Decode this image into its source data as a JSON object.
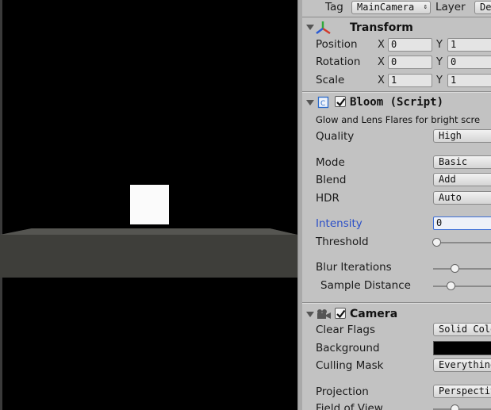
{
  "top": {
    "tag_label": "Tag",
    "tag_value": "MainCamera",
    "layer_label": "Layer",
    "layer_value": "De"
  },
  "transform": {
    "title": "Transform",
    "rows": [
      {
        "label": "Position",
        "x": "0",
        "y": "1"
      },
      {
        "label": "Rotation",
        "x": "0",
        "y": "0"
      },
      {
        "label": "Scale",
        "x": "1",
        "y": "1"
      }
    ],
    "axis_x": "X",
    "axis_y": "Y"
  },
  "bloom": {
    "title": "Bloom (Script)",
    "description": "Glow and Lens Flares for bright scre",
    "quality_label": "Quality",
    "quality_value": "High",
    "mode_label": "Mode",
    "mode_value": "Basic",
    "blend_label": "Blend",
    "blend_value": "Add",
    "hdr_label": "HDR",
    "hdr_value": "Auto",
    "intensity_label": "Intensity",
    "intensity_value": "0",
    "threshold_label": "Threshold",
    "blur_label": "Blur Iterations",
    "sample_label": "Sample Distance"
  },
  "camera": {
    "title": "Camera",
    "clear_flags_label": "Clear Flags",
    "clear_flags_value": "Solid Color",
    "background_label": "Background",
    "background_color": "#000000",
    "culling_label": "Culling Mask",
    "culling_value": "Everything",
    "projection_label": "Projection",
    "projection_value": "Perspective",
    "fov_label": "Field of View"
  },
  "colors": {
    "inspector_bg": "#c2c2c2",
    "focus_blue": "#3d6fd6",
    "label_blue": "#2b4fc7",
    "cube": "#fbfbfb"
  }
}
